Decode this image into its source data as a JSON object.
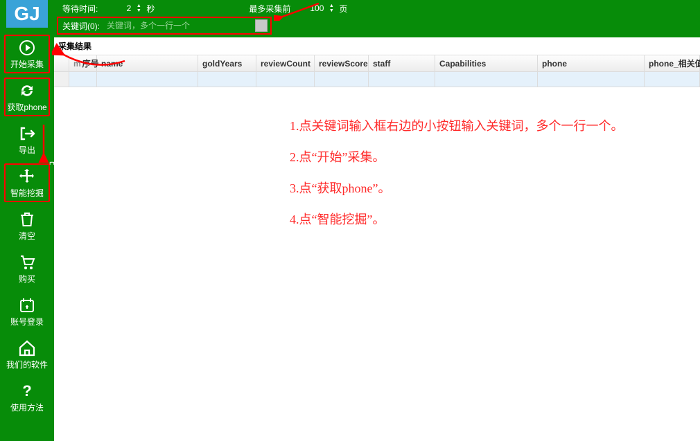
{
  "logo_text": "GJ",
  "sidebar": {
    "items": [
      {
        "label": "开始采集",
        "icon": "play"
      },
      {
        "label": "获取phone",
        "icon": "refresh"
      },
      {
        "label": "导出",
        "icon": "export"
      },
      {
        "label": "智能挖掘",
        "icon": "move"
      },
      {
        "label": "清空",
        "icon": "trash"
      },
      {
        "label": "购买",
        "icon": "cart"
      },
      {
        "label": "账号登录",
        "icon": "calendar"
      },
      {
        "label": "我们的软件",
        "icon": "home"
      },
      {
        "label": "使用方法",
        "icon": "help"
      }
    ]
  },
  "top": {
    "wait_label": "等待时间:",
    "wait_value": "2",
    "wait_unit": "秒",
    "max_label": "最多采集前",
    "max_value": "100",
    "max_unit": "页",
    "keyword_label": "关键词(0):",
    "keyword_placeholder": "关键词，多个一行一个"
  },
  "results_title": "采集结果",
  "columns": [
    "m",
    "序号",
    "name",
    "goldYears",
    "reviewCount",
    "reviewScore",
    "staff",
    "Capabilities",
    "phone",
    "phone_相关值"
  ],
  "instructions": [
    "1.点关键词输入框右边的小按钮输入关键词，多个一行一个。",
    "2.点“开始”采集。",
    "3.点“获取phone”。",
    "4.点“智能挖掘”。"
  ]
}
